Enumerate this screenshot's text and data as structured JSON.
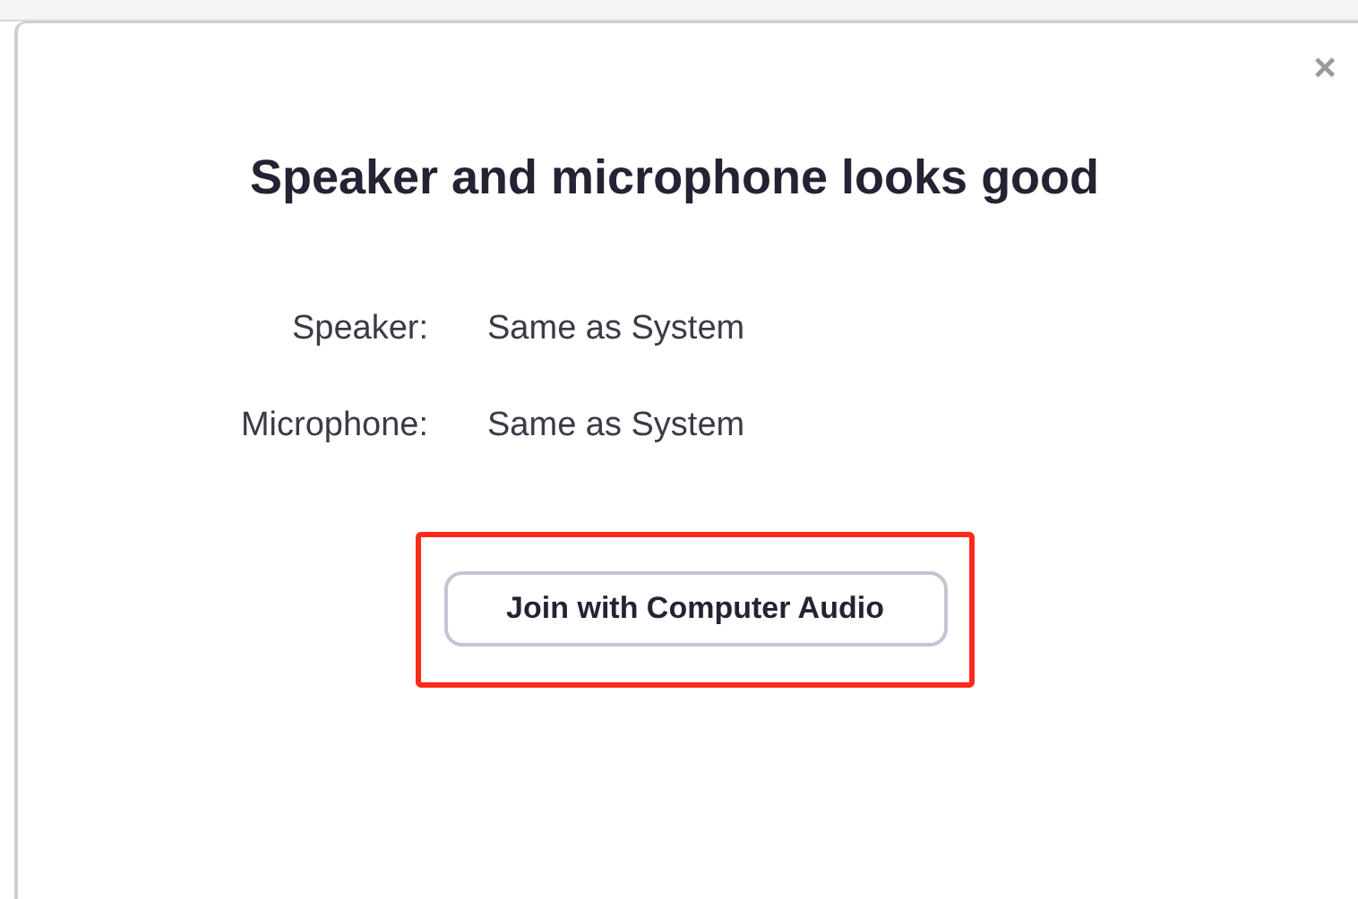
{
  "dialog": {
    "close": "×",
    "title": "Speaker and microphone looks good",
    "fields": [
      {
        "label": "Speaker:",
        "value": "Same as System"
      },
      {
        "label": "Microphone:",
        "value": "Same as System"
      }
    ],
    "button": "Join with Computer Audio"
  }
}
